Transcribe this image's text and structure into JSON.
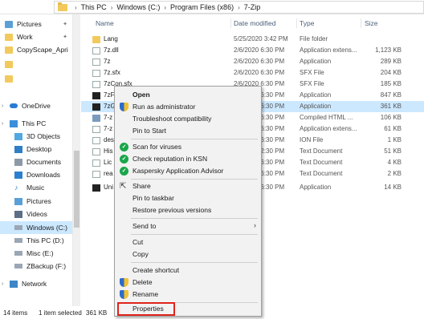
{
  "address": {
    "crumbs": [
      "This PC",
      "Windows (C:)",
      "Program Files (x86)",
      "7-Zip"
    ]
  },
  "sidebar": {
    "items": [
      {
        "label": "Pictures",
        "pinned": true,
        "icon": "pictures-folder-icon"
      },
      {
        "label": "Work",
        "pinned": true,
        "icon": "folder-icon"
      },
      {
        "label": "CopyScape_Apri",
        "pinned": false,
        "icon": "folder-icon"
      },
      {
        "label": "",
        "pinned": false,
        "icon": "folder-icon"
      },
      {
        "label": "",
        "pinned": false,
        "icon": "folder-icon"
      },
      {
        "label": "OneDrive",
        "pinned": false,
        "icon": "onedrive-icon"
      },
      {
        "label": "This PC",
        "pinned": false,
        "icon": "this-pc-icon"
      },
      {
        "label": "3D Objects",
        "pinned": false,
        "icon": "3d-objects-icon"
      },
      {
        "label": "Desktop",
        "pinned": false,
        "icon": "desktop-icon"
      },
      {
        "label": "Documents",
        "pinned": false,
        "icon": "documents-icon"
      },
      {
        "label": "Downloads",
        "pinned": false,
        "icon": "downloads-icon"
      },
      {
        "label": "Music",
        "pinned": false,
        "icon": "music-icon"
      },
      {
        "label": "Pictures",
        "pinned": false,
        "icon": "pictures-icon"
      },
      {
        "label": "Videos",
        "pinned": false,
        "icon": "videos-icon"
      },
      {
        "label": "Windows (C:)",
        "pinned": false,
        "icon": "drive-icon",
        "selected": true
      },
      {
        "label": "This PC (D:)",
        "pinned": false,
        "icon": "drive-icon"
      },
      {
        "label": "Misc (E:)",
        "pinned": false,
        "icon": "drive-icon"
      },
      {
        "label": "ZBackup (F:)",
        "pinned": false,
        "icon": "drive-icon"
      },
      {
        "label": "Network",
        "pinned": false,
        "icon": "network-icon"
      }
    ]
  },
  "columns": {
    "name": "Name",
    "date": "Date modified",
    "type": "Type",
    "size": "Size"
  },
  "files": [
    {
      "name": "Lang",
      "date": "5/25/2020 3:42 PM",
      "type": "File folder",
      "size": ""
    },
    {
      "name": "7z.dll",
      "date": "2/6/2020 6:30 PM",
      "type": "Application extens...",
      "size": "1,123 KB"
    },
    {
      "name": "7z",
      "date": "2/6/2020 6:30 PM",
      "type": "Application",
      "size": "289 KB"
    },
    {
      "name": "7z.sfx",
      "date": "2/6/2020 6:30 PM",
      "type": "SFX File",
      "size": "204 KB"
    },
    {
      "name": "7zCon.sfx",
      "date": "2/6/2020 6:30 PM",
      "type": "SFX File",
      "size": "185 KB"
    },
    {
      "name": "7zF",
      "date": "2/6/2020 6:30 PM",
      "type": "Application",
      "size": "847 KB"
    },
    {
      "name": "7zG",
      "date": "2/6/2020 6:30 PM",
      "type": "Application",
      "size": "361 KB",
      "selected": true
    },
    {
      "name": "7-z",
      "date": "2/6/2020 6:30 PM",
      "type": "Compiled HTML ...",
      "size": "106 KB"
    },
    {
      "name": "7-z",
      "date": "2/6/2020 6:30 PM",
      "type": "Application extens...",
      "size": "61 KB"
    },
    {
      "name": "des",
      "date": "2/6/2020 6:30 PM",
      "type": "ION File",
      "size": "1 KB"
    },
    {
      "name": "His",
      "date": "2/6/2020 2:30 PM",
      "type": "Text Document",
      "size": "51 KB"
    },
    {
      "name": "Lic",
      "date": "2/6/2020 6:30 PM",
      "type": "Text Document",
      "size": "4 KB"
    },
    {
      "name": "rea",
      "date": "2/6/2020 6:30 PM",
      "type": "Text Document",
      "size": "2 KB"
    },
    {
      "name": "Uni",
      "date": "2/6/2020 6:30 PM",
      "type": "Application",
      "size": "14 KB"
    }
  ],
  "status": {
    "items": "14 items",
    "selected": "1 item selected",
    "size": "361 KB"
  },
  "menu": {
    "items": [
      {
        "label": "Open",
        "bold": true,
        "icon": ""
      },
      {
        "label": "Run as administrator",
        "icon": "shield-icon"
      },
      {
        "label": "Troubleshoot compatibility",
        "icon": ""
      },
      {
        "label": "Pin to Start",
        "icon": ""
      },
      {
        "label": "Scan for viruses",
        "icon": "kaspersky-icon"
      },
      {
        "label": "Check reputation in KSN",
        "icon": "kaspersky-icon"
      },
      {
        "label": "Kaspersky Application Advisor",
        "icon": "kaspersky-icon"
      },
      {
        "label": "Share",
        "icon": "share-icon"
      },
      {
        "label": "Pin to taskbar",
        "icon": ""
      },
      {
        "label": "Restore previous versions",
        "icon": ""
      },
      {
        "label": "Send to",
        "icon": "",
        "submenu": true
      },
      {
        "label": "Cut",
        "icon": ""
      },
      {
        "label": "Copy",
        "icon": ""
      },
      {
        "label": "Create shortcut",
        "icon": ""
      },
      {
        "label": "Delete",
        "icon": "shield-icon"
      },
      {
        "label": "Rename",
        "icon": "shield-icon"
      },
      {
        "label": "Properties",
        "icon": "",
        "highlighted": true
      }
    ]
  },
  "colors": {
    "selection": "#cce8ff",
    "highlight_border": "#e0231c",
    "kaspersky_green": "#19a64a"
  }
}
